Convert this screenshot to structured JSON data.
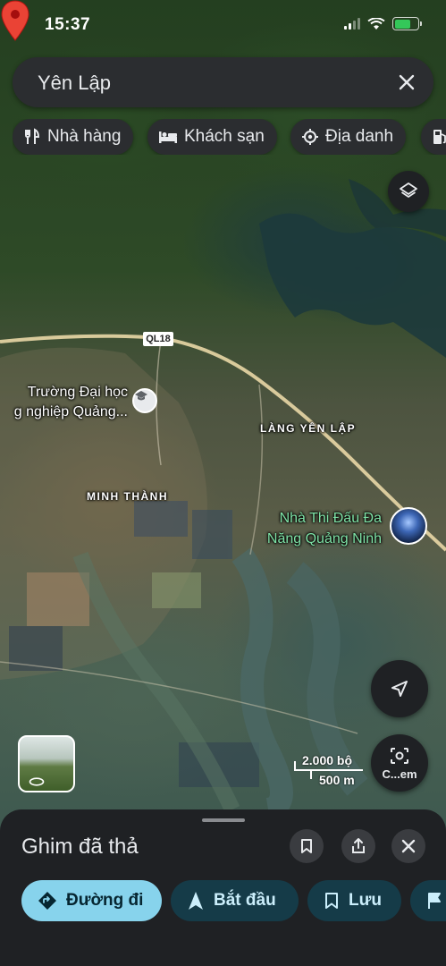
{
  "status_bar": {
    "time": "15:37"
  },
  "search": {
    "query": "Yên Lập"
  },
  "chips": [
    {
      "label": "Nhà hàng",
      "icon": "restaurant-icon"
    },
    {
      "label": "Khách sạn",
      "icon": "hotel-icon"
    },
    {
      "label": "Địa danh",
      "icon": "landmark-icon"
    },
    {
      "label": "",
      "icon": "gas-station-icon"
    }
  ],
  "map": {
    "road_shield": "QL18",
    "university_label": "Trường Đại học\ng nghiệp Quảng...",
    "village_label": "LÀNG YÊN LẬP",
    "commune_label": "MINH THÀNH",
    "venue_label": "Nhà Thi Đấu Đa\nNăng Quảng Ninh",
    "scale_imperial": "2.000 bộ",
    "scale_metric": "500 m",
    "camera_label": "C...em"
  },
  "sheet": {
    "title": "Ghim đã thả",
    "actions": [
      {
        "label": "Đường đi",
        "icon": "directions-icon"
      },
      {
        "label": "Bắt đầu",
        "icon": "navigate-icon"
      },
      {
        "label": "Lưu",
        "icon": "bookmark-icon"
      },
      {
        "label": "",
        "icon": "flag-icon"
      }
    ]
  },
  "colors": {
    "pin": "#ea4335",
    "venue_label": "#7ee2a6",
    "primary_action": "#87d3ec",
    "secondary_action": "#153b48"
  }
}
